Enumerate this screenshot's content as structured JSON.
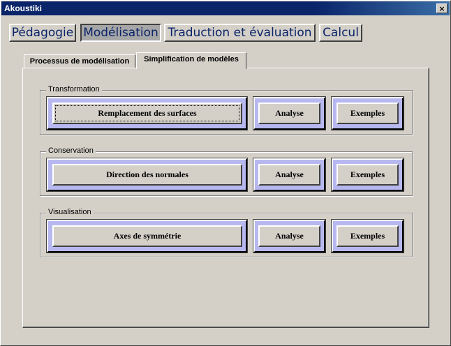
{
  "window": {
    "title": "Akoustiki",
    "close_symbol": "×"
  },
  "top_tabs": [
    {
      "label": "Pédagogie"
    },
    {
      "label": "Modélisation"
    },
    {
      "label": "Traduction et évaluation"
    },
    {
      "label": "Calcul"
    }
  ],
  "sub_tabs": [
    {
      "label": "Processus de modélisation"
    },
    {
      "label": "Simplification de modèles"
    }
  ],
  "groups": [
    {
      "label": "Transformation",
      "main_button": "Remplacement des surfaces",
      "analyse": "Analyse",
      "exemples": "Exemples"
    },
    {
      "label": "Conservation",
      "main_button": "Direction des normales",
      "analyse": "Analyse",
      "exemples": "Exemples"
    },
    {
      "label": "Visualisation",
      "main_button": "Axes de symmétrie",
      "analyse": "Analyse",
      "exemples": "Exemples"
    }
  ],
  "colors": {
    "title_bar": "#0a246a",
    "button_frame": "#b8b8f0",
    "active_tab": "#a6a6a6",
    "tab_text": "#0a246a"
  }
}
